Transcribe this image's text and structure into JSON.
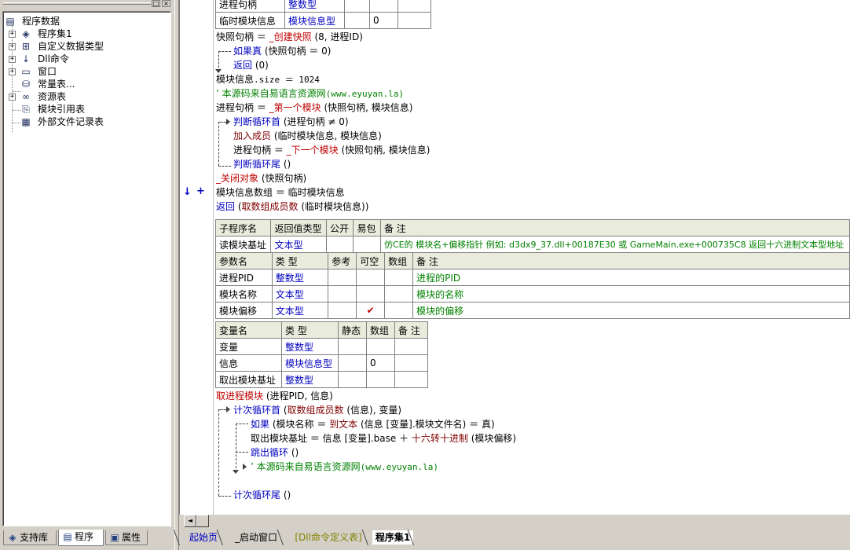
{
  "window_controls": {
    "restore": "□",
    "close": "×"
  },
  "tree": {
    "root": "程序数据",
    "items": [
      {
        "label": "程序集1",
        "icon": "assembly-icon",
        "expandable": true
      },
      {
        "label": "自定义数据类型",
        "icon": "datatype-icon",
        "expandable": true
      },
      {
        "label": "Dll命令",
        "icon": "dll-icon",
        "expandable": true
      },
      {
        "label": "窗口",
        "icon": "window-icon",
        "expandable": true
      },
      {
        "label": "常量表...",
        "icon": "constant-icon",
        "expandable": false
      },
      {
        "label": "资源表",
        "icon": "resource-icon",
        "expandable": true
      },
      {
        "label": "模块引用表",
        "icon": "module-ref-icon",
        "expandable": false
      },
      {
        "label": "外部文件记录表",
        "icon": "file-record-icon",
        "expandable": false
      }
    ]
  },
  "left_tabs": [
    {
      "label": "支持库",
      "icon": "library-icon",
      "active": false
    },
    {
      "label": "程序",
      "icon": "program-icon",
      "active": true
    },
    {
      "label": "属性",
      "icon": "property-icon",
      "active": false
    }
  ],
  "top_table": {
    "rows": [
      [
        "进程句柄",
        "整数型",
        "",
        "",
        ""
      ],
      [
        "临时模块信息",
        "模块信息型",
        "",
        "0",
        ""
      ]
    ]
  },
  "code1": {
    "l1": {
      "a": "快照句柄 ＝ ",
      "b": "_创建快照",
      "c": " (8, 进程ID)"
    },
    "l2": {
      "a": "如果真",
      "b": " (快照句柄 ＝ 0)"
    },
    "l3": {
      "a": "返回",
      "b": " (0)"
    },
    "l4": {
      "a": "模块信息",
      "b": ".size ＝ 1024"
    },
    "l5": {
      "a": "’ 本源码来自易语言资源网",
      "b": "(www.eyuyan.la)"
    },
    "l6": {
      "a": "进程句柄 ＝ ",
      "b": "_第一个模块",
      "c": " (快照句柄, 模块信息)"
    },
    "l7": {
      "a": "判断循环首",
      "b": " (进程句柄 ≠ 0)"
    },
    "l8": {
      "a": "加入成员",
      "b": " (临时模块信息, 模块信息)"
    },
    "l9": {
      "a": "进程句柄 ＝ ",
      "b": "_下一个模块",
      "c": " (快照句柄, 模块信息)"
    },
    "l10": {
      "a": "判断循环尾",
      "b": " ()"
    },
    "l11": {
      "a": "_关闭对象",
      "b": " (快照句柄)"
    },
    "l12": {
      "a": "模块信息数组 ＝ 临时模块信息"
    },
    "l13": {
      "a": "返回",
      "b": " (",
      "c": "取数组成员数",
      "d": " (临时模块信息))"
    }
  },
  "markers": {
    "arrow": "↓",
    "plus": "+"
  },
  "sub_table": {
    "headers": [
      "子程序名",
      "返回值类型",
      "公开",
      "易包",
      "备 注"
    ],
    "row": [
      "读模块基址",
      "文本型",
      "",
      "",
      "仿CE的 模块名+偏移指针 例如: d3dx9_37.dll+00187E30 或 GameMain.exe+000735C8 返回十六进制文本型地址"
    ]
  },
  "param_table": {
    "headers": [
      "参数名",
      "类 型",
      "参考",
      "可空",
      "数组",
      "备 注"
    ],
    "rows": [
      [
        "进程PID",
        "整数型",
        "",
        "",
        "",
        "进程的PID"
      ],
      [
        "模块名称",
        "文本型",
        "",
        "",
        "",
        "模块的名称"
      ],
      [
        "模块偏移",
        "文本型",
        "",
        "✔",
        "",
        "模块的偏移"
      ]
    ]
  },
  "var_table": {
    "headers": [
      "变量名",
      "类 型",
      "静态",
      "数组",
      "备 注"
    ],
    "rows": [
      [
        "变量",
        "整数型",
        "",
        "",
        ""
      ],
      [
        "信息",
        "模块信息型",
        "",
        "0",
        ""
      ],
      [
        "取出模块基址",
        "整数型",
        "",
        "",
        ""
      ]
    ]
  },
  "code2": {
    "l1": {
      "a": "取进程模块",
      "b": " (进程PID, 信息)"
    },
    "l2": {
      "a": "计次循环首",
      "b": " (",
      "c": "取数组成员数",
      "d": " (信息), 变量)"
    },
    "l3": {
      "a": "如果",
      "b": " (模块名称 ＝ ",
      "c": "到文本",
      "d": " (信息 [变量].模块文件名) ＝ 真)"
    },
    "l4": {
      "a": "取出模块基址 ＝ 信息 [变量].base ＋ ",
      "b": "十六转十进制",
      "c": " (模块偏移)"
    },
    "l5": {
      "a": "跳出循环",
      "b": " ()"
    },
    "l6": {
      "a": "’ 本源码来自易语言资源网",
      "b": "(www.eyuyan.la)"
    },
    "l7": {
      "a": "计次循环尾",
      "b": " ()"
    }
  },
  "doc_tabs": [
    {
      "label": "起始页",
      "active": false,
      "color": "#0000c0"
    },
    {
      "label": "_启动窗口",
      "active": false,
      "color": "#000000"
    },
    {
      "label": "[Dll命令定义表]",
      "active": false,
      "color": "#808000"
    },
    {
      "label": "程序集1",
      "active": true,
      "color": "#000000"
    }
  ],
  "scroll": {
    "left": "◄"
  }
}
